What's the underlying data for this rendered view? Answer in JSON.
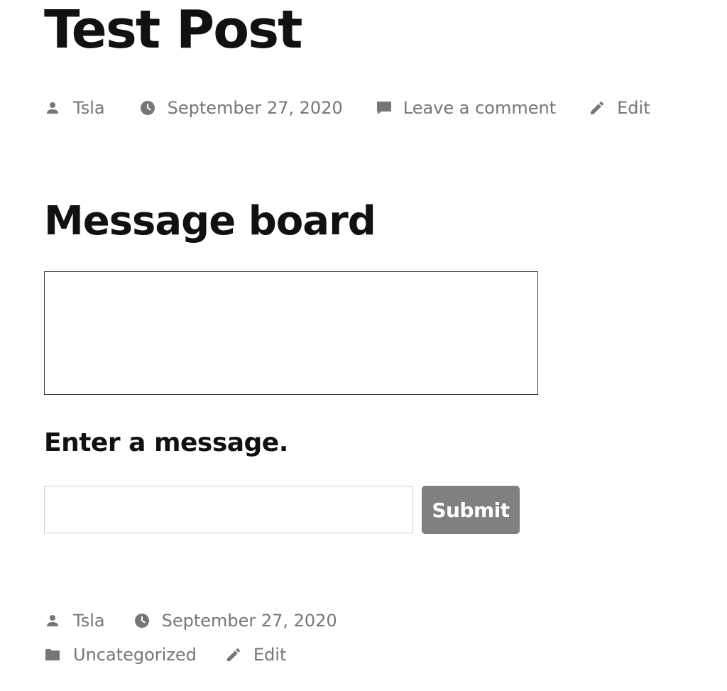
{
  "post": {
    "title": "Test Post",
    "header_meta": {
      "author": "Tsla",
      "date": "September 27, 2020",
      "comment_link": "Leave a comment",
      "edit_link": "Edit"
    }
  },
  "board": {
    "heading": "Message board",
    "prompt": "Enter a message.",
    "input": {
      "value": "",
      "placeholder": ""
    },
    "submit_label": "Submit"
  },
  "footer_meta": {
    "author": "Tsla",
    "date": "September 27, 2020",
    "category": "Uncategorized",
    "edit_link": "Edit"
  },
  "icons": {
    "author": "person-icon",
    "date": "clock-icon",
    "comment": "speech-bubble-icon",
    "edit": "pencil-icon",
    "category": "folder-icon"
  },
  "colors": {
    "text": "#111111",
    "meta": "#767676",
    "button_bg": "#808080",
    "button_text": "#ffffff",
    "box_border": "#3a3a3a",
    "input_border": "#cfcfcf"
  }
}
